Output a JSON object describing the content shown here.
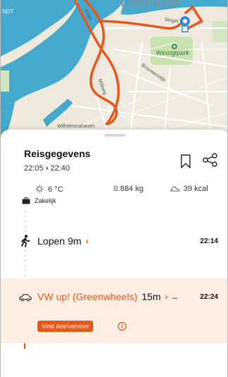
{
  "map": {
    "city_label": "Dordrecht",
    "street_singel": "Singel",
    "park_label": "Weizigtpark",
    "street_brouwersdijk": "Brouwersdijk",
    "street_millweg": "Millweg",
    "street_lindt": "Lindt",
    "street_wilhelmina": "Wilhelminahaven",
    "edge_label": "NDT"
  },
  "trip": {
    "title": "Reisgegevens",
    "start_time": "22:05",
    "end_time": "22:40"
  },
  "stats": {
    "temperature": "6 °C",
    "co2": "0.884 kg",
    "calories": "39 kcal"
  },
  "category": "Zakelijk",
  "legs": [
    {
      "label": "Lopen 9m",
      "time": "22:14",
      "icon": "walking-icon"
    },
    {
      "label": "VW up! (Greenwheels)",
      "duration": "15m",
      "ellipsis": "...",
      "time": "22:24",
      "icon": "car-icon",
      "action": "Vind deelvervoer"
    }
  ],
  "colors": {
    "accent": "#e8561a",
    "route": "#e8561a",
    "water": "#3fa6c9",
    "map_marker": "#2f8ae0",
    "car_leg_bg": "#fdeee4"
  }
}
